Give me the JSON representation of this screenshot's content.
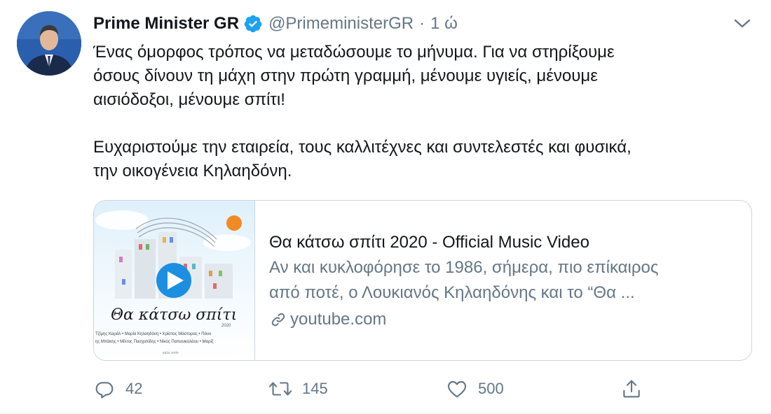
{
  "tweet": {
    "author_name": "Prime Minister GR",
    "handle": "@PrimeministerGR",
    "separator": "·",
    "time": "1 ώ",
    "text": "Ένας όμορφος τρόπος να μεταδώσουμε το μήνυμα. Για να στηρίξουμε\nόσους δίνουν τη μάχη στην πρώτη γραμμή, μένουμε υγιείς, μένουμε\nαισιόδοξοι, μένουμε σπίτι!\n\nΕυχαριστούμε την εταιρεία, τους καλλιτέχνες και συντελεστές και φυσικά,\nτην οικογένεια Κηλαηδόνη."
  },
  "card": {
    "title": "Θα κάτσω σπίτι 2020 - Official Music Video",
    "description_line1": "Αν και κυκλοφόρησε το 1986, σήμερα, πιο επίκαιρος",
    "description_line2": "από ποτέ, ο Λουκιανός Κηλαηδόνης και το “Θα ...",
    "domain": "youtube.com",
    "thumbnail": {
      "title_text": "Θα κάτσω σπίτι",
      "year": "2020",
      "credits_line1": "Τζίμης Καράλ • Μαρία Κηλαηδόνη • Χρίστος Μάστορας • Πάνο",
      "credits_line2": "ης Μπάκης • Μίλτος Πασχαλίδης • Νίκος Παπανικολάου • Μαρίζ",
      "footer": "καλό σπίτι"
    }
  },
  "actions": {
    "replies": "42",
    "retweets": "145",
    "likes": "500"
  },
  "colors": {
    "text": "#14171a",
    "secondary": "#657786",
    "accent": "#1da1f2",
    "border": "#ccd6dd",
    "play": "#1d8fe0",
    "sun": "#f08a24"
  },
  "icons": {
    "verified": "verified-badge-icon",
    "caret": "chevron-down-icon",
    "link": "link-icon",
    "reply": "reply-icon",
    "retweet": "retweet-icon",
    "like": "heart-icon",
    "share": "share-icon",
    "play": "play-icon"
  }
}
